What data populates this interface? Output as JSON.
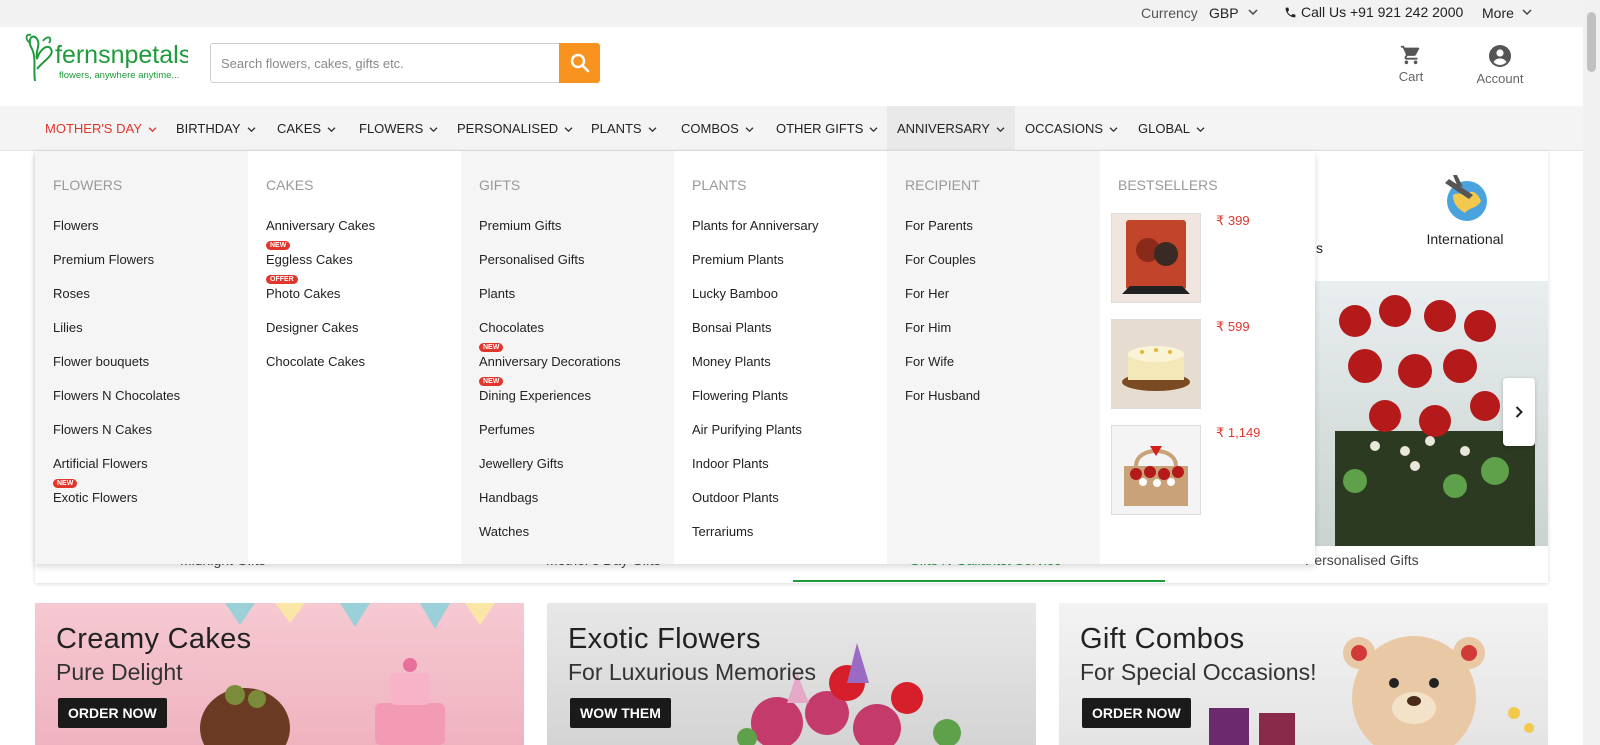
{
  "topbar": {
    "currency_label": "Currency",
    "currency_value": "GBP",
    "call_label": "Call Us +91 921 242 2000",
    "more_label": "More"
  },
  "header": {
    "logo_name": "fernsnpetals",
    "logo_tagline": "flowers, anywhere anytime...",
    "search_placeholder": "Search flowers, cakes, gifts etc.",
    "cart_label": "Cart",
    "account_label": "Account"
  },
  "nav": [
    {
      "label": "MOTHER'S DAY"
    },
    {
      "label": "BIRTHDAY"
    },
    {
      "label": "CAKES"
    },
    {
      "label": "FLOWERS"
    },
    {
      "label": "PERSONALISED"
    },
    {
      "label": "PLANTS"
    },
    {
      "label": "COMBOS"
    },
    {
      "label": "OTHER GIFTS"
    },
    {
      "label": "ANNIVERSARY"
    },
    {
      "label": "OCCASIONS"
    },
    {
      "label": "GLOBAL"
    }
  ],
  "mega": {
    "flowers": {
      "heading": "FLOWERS",
      "links": [
        "Flowers",
        "Premium Flowers",
        "Roses",
        "Lilies",
        "Flower bouquets",
        "Flowers N Chocolates",
        "Flowers N Cakes",
        "Artificial Flowers",
        "Exotic Flowers"
      ],
      "exotic_badge": "NEW"
    },
    "cakes": {
      "heading": "CAKES",
      "links": [
        "Anniversary Cakes",
        "Eggless Cakes",
        "Photo Cakes",
        "Designer Cakes",
        "Chocolate Cakes"
      ],
      "eggless_badge": "NEW",
      "photo_badge": "OFFER"
    },
    "gifts": {
      "heading": "GIFTS",
      "links": [
        "Premium Gifts",
        "Personalised Gifts",
        "Plants",
        "Chocolates",
        "Anniversary Decorations",
        "Dining Experiences",
        "Perfumes",
        "Jewellery Gifts",
        "Handbags",
        "Watches"
      ],
      "decorations_badge": "NEW",
      "dining_badge": "NEW"
    },
    "plants": {
      "heading": "PLANTS",
      "links": [
        "Plants for Anniversary",
        "Premium Plants",
        "Lucky Bamboo",
        "Bonsai Plants",
        "Money Plants",
        "Flowering Plants",
        "Air Purifying Plants",
        "Indoor Plants",
        "Outdoor Plants",
        "Terrariums"
      ]
    },
    "recipient": {
      "heading": "RECIPIENT",
      "links": [
        "For Parents",
        "For Couples",
        "For Her",
        "For Him",
        "For Wife",
        "For Husband"
      ]
    },
    "bestsellers": {
      "heading": "BESTSELLERS",
      "prices": [
        "₹ 399",
        "₹ 599",
        "₹ 1,149"
      ]
    }
  },
  "behind": {
    "international_label": "International",
    "partial_label": "s",
    "tabs": [
      "Midnight Gifts",
      "Mother's Day Gifts",
      "Gifts N Gallantst Service",
      "Personalised Gifts"
    ]
  },
  "banners": [
    {
      "title": "Creamy Cakes",
      "subtitle": "Pure Delight",
      "button": "ORDER NOW"
    },
    {
      "title": "Exotic Flowers",
      "subtitle": "For Luxurious Memories",
      "button": "WOW THEM"
    },
    {
      "title": "Gift Combos",
      "subtitle": "For Special Occasions!",
      "button": "ORDER NOW"
    }
  ],
  "colors": {
    "accent_orange": "#f7931e",
    "active_red": "#e0362c",
    "logo_green": "#1e9b3a"
  }
}
